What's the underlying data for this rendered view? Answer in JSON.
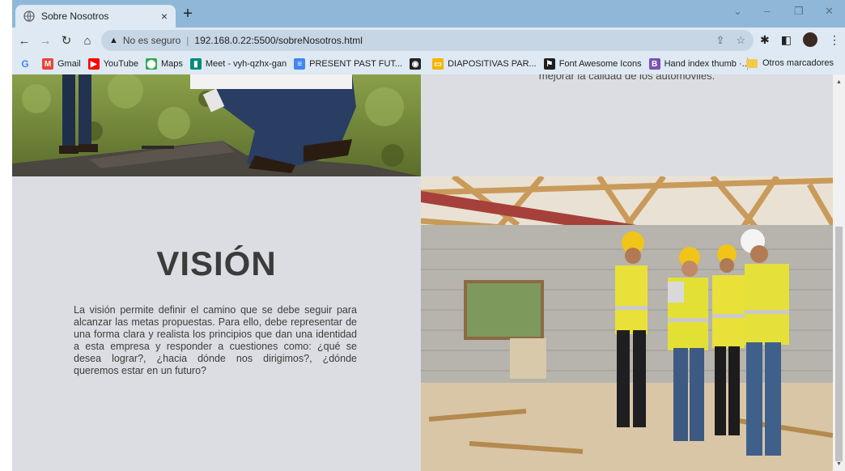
{
  "browser": {
    "tab_title": "Sobre Nosotros",
    "tab_close": "×",
    "new_tab": "+",
    "address": {
      "security_label": "No es seguro",
      "url": "192.168.0.22:5500/sobreNosotros.html"
    },
    "window_controls": [
      "⌄",
      "–",
      "❐",
      "✕"
    ],
    "bookmarks": [
      {
        "label": "Gmail",
        "icon": "gmail-icon",
        "color": "#ea4335",
        "glyph": "M"
      },
      {
        "label": "YouTube",
        "icon": "youtube-icon",
        "color": "#ff0000",
        "glyph": "▶"
      },
      {
        "label": "Maps",
        "icon": "maps-icon",
        "color": "#34a853",
        "glyph": "⬤"
      },
      {
        "label": "Meet - vyh-qzhx-gan",
        "icon": "meet-icon",
        "color": "#00897b",
        "glyph": "▮"
      },
      {
        "label": "PRESENT PAST FUT...",
        "icon": "docs-icon",
        "color": "#4285f4",
        "glyph": "≡"
      },
      {
        "label": "",
        "icon": "globe-icon",
        "color": "#202124",
        "glyph": "◉"
      },
      {
        "label": "DIAPOSITIVAS PAR...",
        "icon": "slides-icon",
        "color": "#f4b400",
        "glyph": "▭"
      },
      {
        "label": "Font Awesome Icons",
        "icon": "fontawesome-icon",
        "color": "#1e1e1e",
        "glyph": "⚑"
      },
      {
        "label": "Hand index thumb ·...",
        "icon": "bootstrap-icon",
        "color": "#7952b3",
        "glyph": "B"
      }
    ],
    "other_bookmarks": "Otros marcadores"
  },
  "page": {
    "top_text": "mejorar la calidad de los automóviles.",
    "vision_title": "VISIÓN",
    "vision_text": "La visión permite definir el camino que se debe seguir para alcanzar las metas propuestas. Para ello, debe representar de una forma clara y realista los principios que dan una identidad a esta empresa y responder a cuestiones como: ¿qué se desea lograr?, ¿hacia dónde nos dirigimos?, ¿dónde queremos estar en un futuro?"
  },
  "colors": {
    "titlebar": "#8fb8d8",
    "toolbar": "#dee9f3",
    "page_bg": "#dcdde2"
  }
}
